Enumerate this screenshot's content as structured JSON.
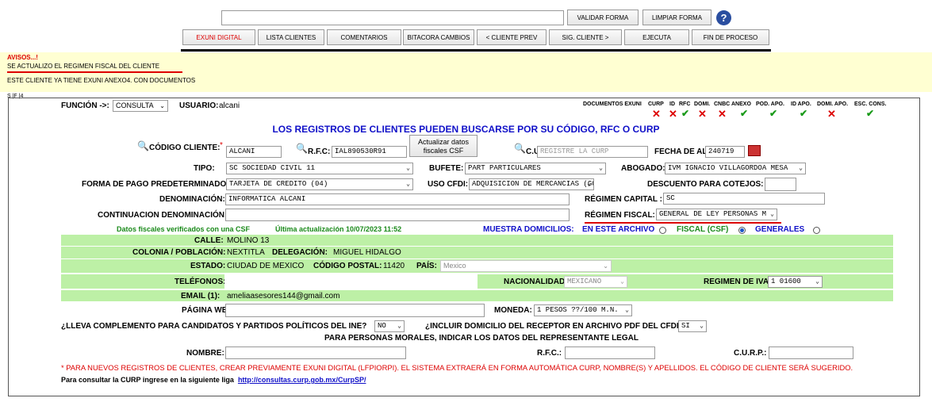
{
  "toolbar": {
    "validar": "VALIDAR FORMA",
    "limpiar": "LIMPIAR FORMA",
    "help": "?"
  },
  "nav": {
    "exuni": "EXUNI DIGITAL",
    "lista": "LISTA CLIENTES",
    "comentarios": "COMENTARIOS",
    "bitacora": "BITACORA CAMBIOS",
    "prev": "< CLIENTE PREV",
    "sig": "SIG. CLIENTE >",
    "ejecuta": "EJECUTA",
    "fin": "FIN DE PROCESO"
  },
  "avisos": {
    "title": "AVISOS...!",
    "line1": "SE ACTUALIZO EL REGIMEN FISCAL DEL CLIENTE",
    "line2": "ESTE CLIENTE YA TIENE EXUNI ANEXO4. CON DOCUMENTOS"
  },
  "sf_marker": "S |F |4",
  "header": {
    "funcion_label": "FUNCIÓN ->:",
    "funcion_value": "CONSULTA",
    "usuario_label": "USUARIO:",
    "usuario_value": "alcani",
    "docs_label": "DOCUMENTOS EXUNI",
    "doc_columns": [
      "CURP",
      "ID",
      "RFC",
      "DOMI.",
      "CNBC",
      "ANEXO",
      "POD. APO.",
      "ID APO.",
      "DOMI. APO.",
      "ESC. CONS."
    ],
    "doc_status": [
      "x",
      "x",
      "check",
      "x",
      "x",
      "check",
      "check",
      "check",
      "x",
      "check"
    ],
    "title": "LOS REGISTROS DE CLIENTES PUEDEN BUSCARSE POR SU CÓDIGO, RFC O CURP"
  },
  "form": {
    "codigo_label": "CÓDIGO CLIENTE:",
    "codigo_required": "*",
    "codigo_value": "ALCANI",
    "rfc_label": "R.F.C:",
    "rfc_value": "IAL890530R91",
    "actualizar_btn": "Actualizar datos fiscales CSF",
    "curp_label": "C.U.R.P.:",
    "curp_placeholder": "REGISTRE LA CURP",
    "fecha_label": "FECHA DE ALTA:",
    "fecha_value": "240719",
    "tipo_label": "TIPO:",
    "tipo_value": "SC SOCIEDAD CIVIL 11",
    "bufete_label": "BUFETE:",
    "bufete_value": "PART PARTICULARES",
    "abogado_label": "ABOGADO:",
    "abogado_value": "IVM IGNACIO VILLAGORDOA MESA",
    "forma_pago_label": "FORMA DE PAGO PREDETERMINADO:",
    "forma_pago_value": "TARJETA DE CREDITO (04)",
    "uso_cfdi_label": "USO CFDI:",
    "uso_cfdi_value": "ADQUISICION DE MERCANCIAS (G01)",
    "descuento_label": "DESCUENTO PARA COTEJOS:",
    "denominacion_label": "DENOMINACIÓN:",
    "denominacion_value": "INFORMATICA ALCANI",
    "regimen_capital_label": "RÉGIMEN CAPITAL :",
    "regimen_capital_value": "SC",
    "continuacion_label": "CONTINUACION DENOMINACIÓN:",
    "regimen_fiscal_label": "RÉGIMEN FISCAL:",
    "regimen_fiscal_value": "GENERAL DE LEY PERSONAS M",
    "csf_verified": "Datos fiscales verificados con una CSF",
    "ultima_act": "Última actualización 10/07/2023  11:52",
    "muestra_dom": "MUESTRA DOMICILIOS:",
    "en_archivo": "EN ESTE ARCHIVO",
    "fiscal_csf": "FISCAL (CSF)",
    "generales": "GENERALES",
    "calle_label": "CALLE:",
    "calle_value": "MOLINO 13",
    "colonia_label": "COLONIA / POBLACIÓN:",
    "colonia_value": "NEXTITLA",
    "delegacion_label": "DELEGACIÓN:",
    "delegacion_value": "MIGUEL HIDALGO",
    "estado_label": "ESTADO:",
    "estado_value": "CIUDAD DE MEXICO",
    "cp_label": "CÓDIGO POSTAL:",
    "cp_value": "11420",
    "pais_label": "PAÍS:",
    "pais_value": "Mexico",
    "telefonos_label": "TELÉFONOS:",
    "nacionalidad_label": "NACIONALIDAD",
    "nacionalidad_value": "MEXICANO",
    "regimen_iva_label": "REGIMEN DE IVA",
    "regimen_iva_value": "1 01600",
    "email_label": "EMAIL (1):",
    "email_value": "ameliaasesores144@gmail.com",
    "pagina_label": "PÁGINA WEB:",
    "moneda_label": "MONEDA:",
    "moneda_value": "1 PESOS ??/100 M.N.",
    "complemento_label": "¿LLEVA COMPLEMENTO PARA CANDIDATOS Y PARTIDOS POLÍTICOS DEL INE?",
    "complemento_value": "NO",
    "incluir_label": "¿INCLUIR DOMICILIO DEL RECEPTOR EN ARCHIVO PDF DEL CFDI?",
    "incluir_value": "SI",
    "morales_label": "PARA PERSONAS MORALES, INDICAR LOS DATOS DEL REPRESENTANTE LEGAL",
    "nombre_label": "NOMBRE:",
    "rep_rfc_label": "R.F.C.:",
    "rep_curp_label": "C.U.R.P.:",
    "nota": "* PARA NUEVOS REGISTROS DE CLIENTES, CREAR PREVIAMENTE EXUNI DIGITAL (LFPIORPI). EL SISTEMA EXTRAERÁ EN FORMA AUTOMÁTICA CURP, NOMBRE(S) Y APELLIDOS. EL CÓDIGO DE CLIENTE SERÁ SUGERIDO.",
    "consulta_text": "Para consultar la CURP ingrese en la siguiente liga",
    "consulta_link": "http://consultas.curp.gob.mx/CurpSP/"
  },
  "colors": {
    "green_row": "#bdf0a6",
    "title_blue": "#1010c8",
    "alert_red": "#d00000",
    "avisos_bg": "#ffffd2"
  }
}
